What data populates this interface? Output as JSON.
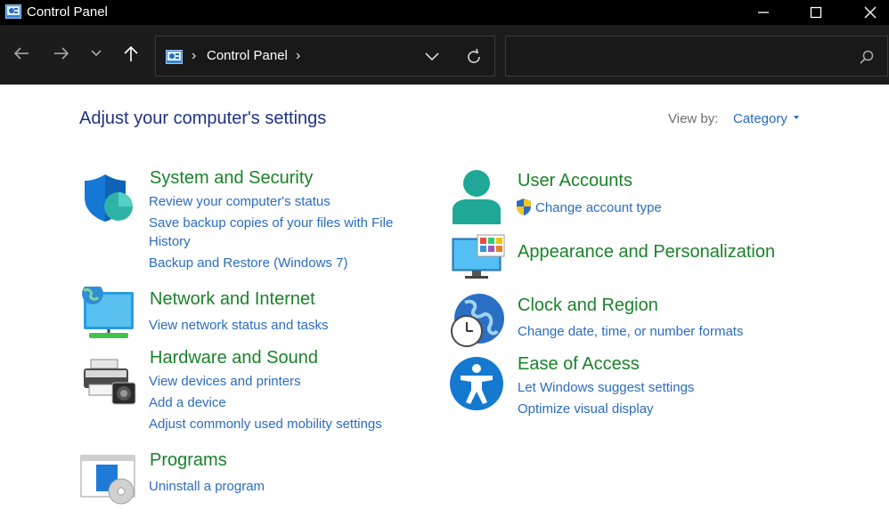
{
  "window": {
    "title": "Control Panel",
    "controls": {
      "minimize": "minimize-icon",
      "maximize": "maximize-icon",
      "close": "close-icon"
    }
  },
  "navigation": {
    "back": "back-arrow-icon",
    "forward": "forward-arrow-icon",
    "recent": "chevron-down-icon",
    "up": "up-arrow-icon",
    "breadcrumb": {
      "separator": "›",
      "items": [
        "Control Panel"
      ]
    },
    "refresh": "refresh-icon",
    "search": {
      "placeholder": "",
      "value": "",
      "icon": "search-icon"
    }
  },
  "main": {
    "heading": "Adjust your computer's settings",
    "view_by": {
      "label": "View by:",
      "value": "Category"
    }
  },
  "categories": {
    "system_security": {
      "icon": "shield-icon",
      "title": "System and Security",
      "links": [
        "Review your computer's status",
        "Save backup copies of your files with File",
        "History",
        "Backup and Restore (Windows 7)"
      ]
    },
    "network_internet": {
      "icon": "network-globe-icon",
      "title": "Network and Internet",
      "links": [
        "View network status and tasks"
      ]
    },
    "hardware_sound": {
      "icon": "printer-speaker-icon",
      "title": "Hardware and Sound",
      "links": [
        "View devices and printers",
        "Add a device",
        "Adjust commonly used mobility settings"
      ]
    },
    "programs": {
      "icon": "programs-disc-icon",
      "title": "Programs",
      "links": [
        "Uninstall a program"
      ]
    },
    "user_accounts": {
      "icon": "user-avatar-icon",
      "title": "User Accounts",
      "links": [
        "Change account type"
      ],
      "link_icon": "uac-shield-icon"
    },
    "appearance": {
      "icon": "monitor-palette-icon",
      "title": "Appearance and Personalization",
      "links": []
    },
    "clock_region": {
      "icon": "globe-clock-icon",
      "title": "Clock and Region",
      "links": [
        "Change date, time, or number formats"
      ]
    },
    "ease_access": {
      "icon": "accessibility-icon",
      "title": "Ease of Access",
      "links": [
        "Let Windows suggest settings",
        "Optimize visual display"
      ]
    }
  },
  "colors": {
    "heading": "#1e3287",
    "category_title": "#1a8229",
    "link": "#2a6cc0",
    "titlebar_bg": "#000000",
    "navbar_bg": "#1c1c1c"
  }
}
